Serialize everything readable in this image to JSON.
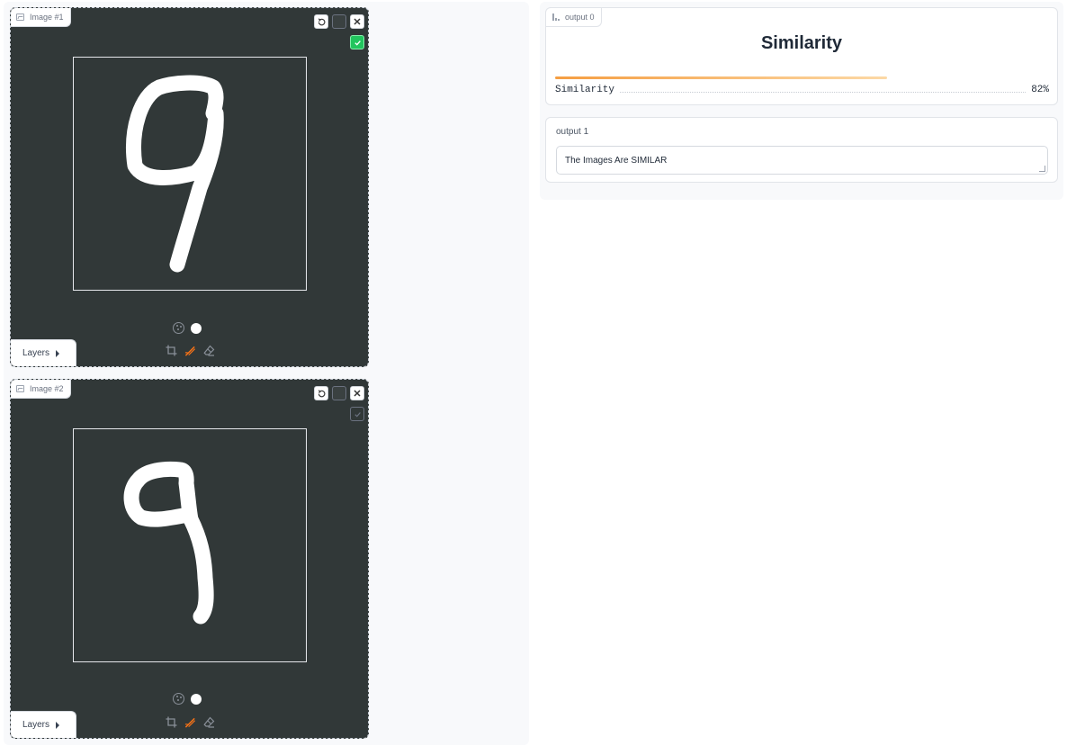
{
  "left": {
    "sketchpads": [
      {
        "label": "Image #1",
        "confirm_state": "checked",
        "layers_label": "Layers"
      },
      {
        "label": "Image #2",
        "confirm_state": "unchecked",
        "layers_label": "Layers"
      }
    ],
    "brush_color": "#ffffff",
    "active_tool": "brush",
    "accent": "#f97316"
  },
  "output0": {
    "label": "output 0",
    "title": "Similarity",
    "row_label": "Similarity",
    "row_value": "82%",
    "confidence": 0.82
  },
  "output1": {
    "label": "output 1",
    "value": "The Images Are SIMILAR"
  }
}
